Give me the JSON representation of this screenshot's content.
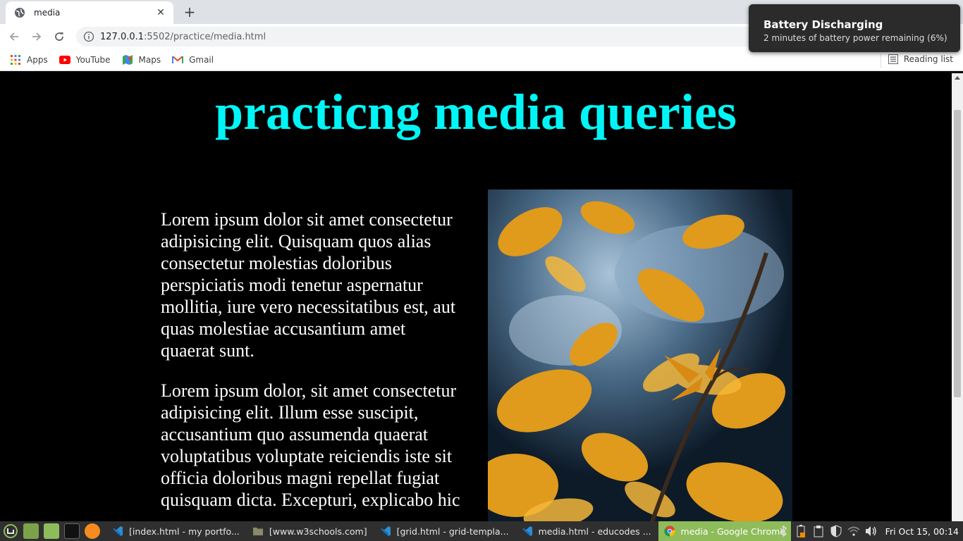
{
  "browser": {
    "tab_title": "media",
    "new_tab_symbol": "+",
    "close_symbol": "✕",
    "url_host": "127.0.0.1",
    "url_path": ":5502/practice/media.html",
    "bookmarks": [
      "Apps",
      "YouTube",
      "Maps",
      "Gmail"
    ],
    "reading_list": "Reading list"
  },
  "notification": {
    "title": "Battery Discharging",
    "body": "2 minutes of battery power remaining (6%)"
  },
  "page": {
    "heading": "practicng media queries",
    "paragraphs": [
      "Lorem ipsum dolor sit amet consectetur adipisicing elit. Quisquam quos alias consectetur molestias doloribus perspiciatis modi tenetur aspernatur mollitia, iure vero necessitatibus est, aut quas molestiae accusantium amet quaerat sunt.",
      "Lorem ipsum dolor, sit amet consectetur adipisicing elit. Illum esse suscipit, accusantium quo assumenda quaerat voluptatibus voluptate reiciendis iste sit officia doloribus magni repellat fugiat quisquam dicta. Excepturi, explicabo hic"
    ],
    "image_subject": "orange autumn leaves photo"
  },
  "taskbar": {
    "windows": [
      "[index.html - my portfo...",
      "[www.w3schools.com]",
      "[grid.html - grid-templa...",
      "media.html - educodes ...",
      "media - Google Chrome"
    ],
    "clock": "Fri Oct 15, 00:14"
  },
  "colors": {
    "heading": "#00f6f6",
    "page_background": "#000000",
    "active_task": "#8ebc5a"
  }
}
